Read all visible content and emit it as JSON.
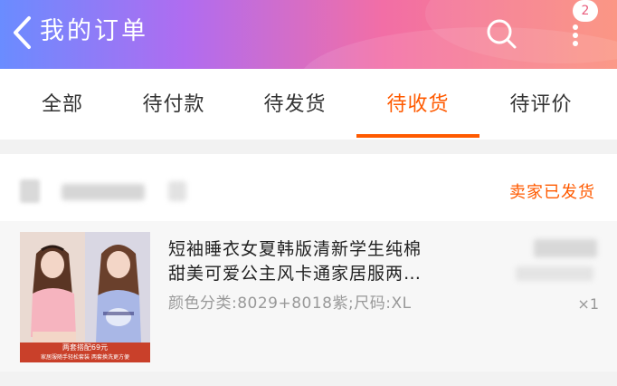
{
  "header": {
    "title": "我的订单",
    "badge_count": "2",
    "colors": {
      "gradient_start": "#6a8cff",
      "gradient_end": "#fb8e7a"
    },
    "icons": [
      "back-arrow-icon",
      "search-icon",
      "more-vertical-icon"
    ]
  },
  "tabs": {
    "active_index": 3,
    "items": [
      {
        "label": "全部"
      },
      {
        "label": "待付款"
      },
      {
        "label": "待发货"
      },
      {
        "label": "待收货"
      },
      {
        "label": "待评价"
      }
    ],
    "active_color": "#ff5a00"
  },
  "order": {
    "status": "卖家已发货",
    "item": {
      "title_line1": "短袖睡衣女夏韩版清新学生纯棉",
      "title_line2": "甜美可爱公主风卡通家居服两…",
      "spec": "颜色分类:8029+8018紫;尺码:XL",
      "quantity": "×1",
      "thumb_caption1": "两套搭配69元",
      "thumb_caption2": "家居服随手轻松套装 两套换洗更方便"
    }
  }
}
